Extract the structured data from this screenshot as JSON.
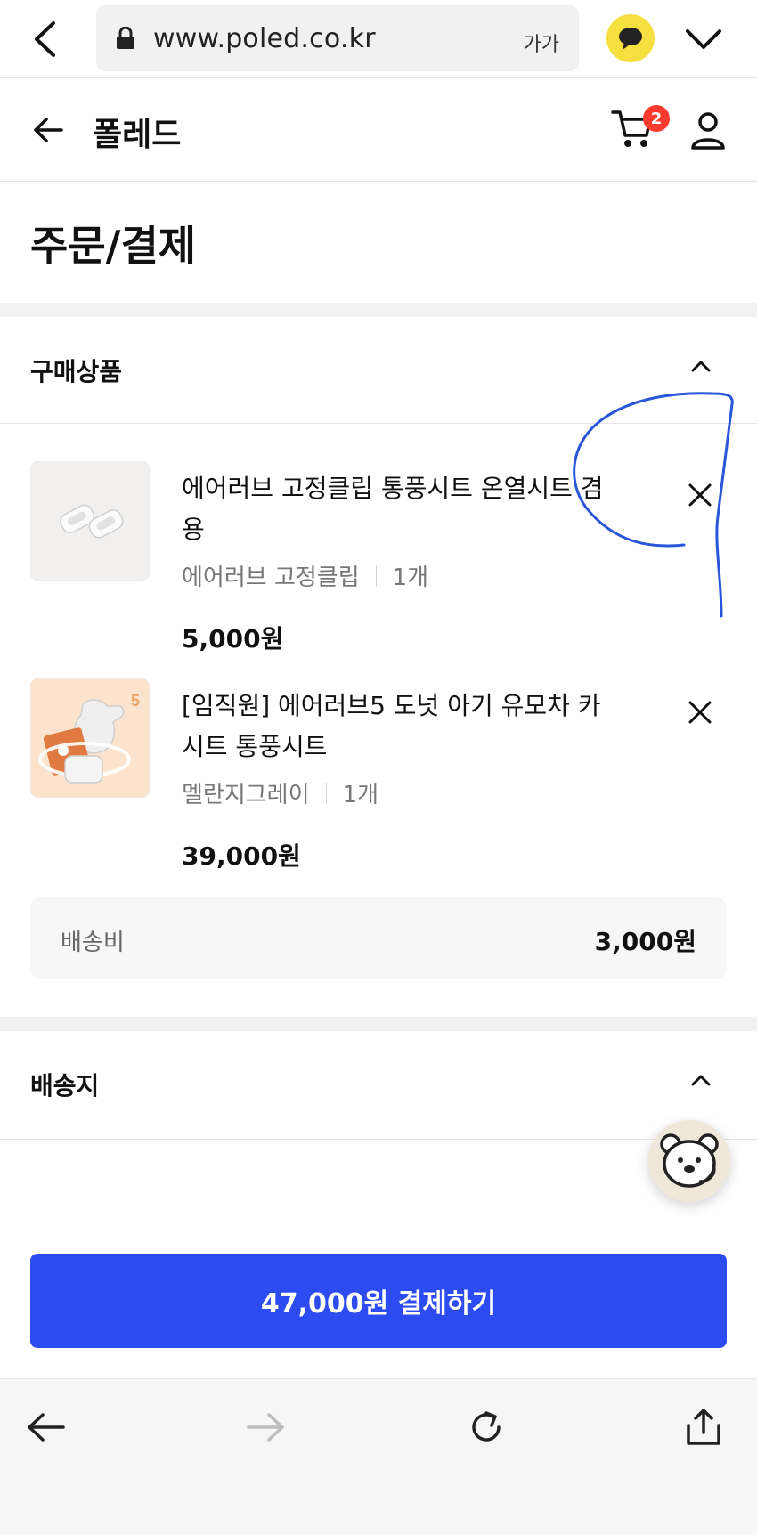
{
  "browser": {
    "url": "www.poled.co.kr",
    "text_size_label": "가가"
  },
  "header": {
    "brand": "폴레드",
    "cart_count": "2"
  },
  "page": {
    "title": "주문/결제"
  },
  "sections": {
    "products_title": "구매상품",
    "address_title": "배송지"
  },
  "products": [
    {
      "title": "에어러브 고정클립 통풍시트 온열시트 겸용",
      "option": "에어러브 고정클립",
      "quantity": "1개",
      "price": "5,000원"
    },
    {
      "title": "[임직원] 에어러브5 도넛 아기 유모차 카시트 통풍시트",
      "option": "멜란지그레이",
      "quantity": "1개",
      "price": "39,000원",
      "badge": "5"
    }
  ],
  "shipping": {
    "label": "배송비",
    "value": "3,000원"
  },
  "pay_button": "47,000원 결제하기",
  "colors": {
    "primary": "#2c4bf0",
    "badge": "#ff3b30",
    "kakao": "#f5e040",
    "annotation": "#2a57d9"
  },
  "icons": [
    "back-icon",
    "lock-icon",
    "kakao-chat-icon",
    "chevron-down-icon",
    "arrow-left-icon",
    "cart-icon",
    "user-icon",
    "chevron-up-icon",
    "close-icon",
    "bear-chatbot-icon",
    "forward-icon",
    "refresh-icon",
    "share-icon"
  ]
}
